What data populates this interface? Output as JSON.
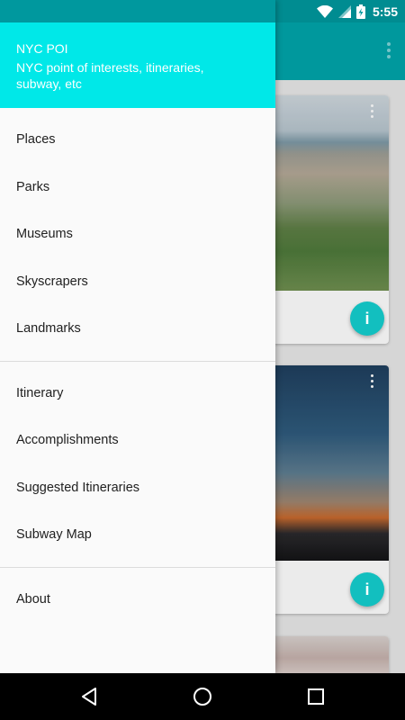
{
  "status_bar": {
    "time": "5:55",
    "icons": [
      "wifi-icon",
      "cell-signal-icon",
      "battery-charging-icon"
    ]
  },
  "app_bar": {
    "overflow_icon": "more-vert-icon"
  },
  "cards": [
    {
      "image": "aerial-central-park",
      "menu_icon": "more-vert-icon",
      "fab_label": "i"
    },
    {
      "image": "skyline-sunset",
      "menu_icon": "more-vert-icon",
      "fab_label": "i"
    },
    {
      "image": "partial-card-image"
    }
  ],
  "drawer": {
    "header": {
      "title": "NYC POI",
      "subtitle": "NYC point of interests, itineraries, subway, etc"
    },
    "groups": [
      {
        "items": [
          {
            "label": "Places"
          },
          {
            "label": "Parks"
          },
          {
            "label": "Museums"
          },
          {
            "label": "Skyscrapers"
          },
          {
            "label": "Landmarks"
          }
        ]
      },
      {
        "items": [
          {
            "label": "Itinerary"
          },
          {
            "label": "Accomplishments"
          },
          {
            "label": "Suggested Itineraries"
          },
          {
            "label": "Subway Map"
          }
        ]
      },
      {
        "items": [
          {
            "label": "About"
          }
        ]
      }
    ]
  },
  "nav_bar": {
    "buttons": [
      "back-icon",
      "home-icon",
      "recents-icon"
    ]
  },
  "colors": {
    "header": "#00e8e8",
    "status": "#00989e",
    "fab": "#12bfbf"
  }
}
